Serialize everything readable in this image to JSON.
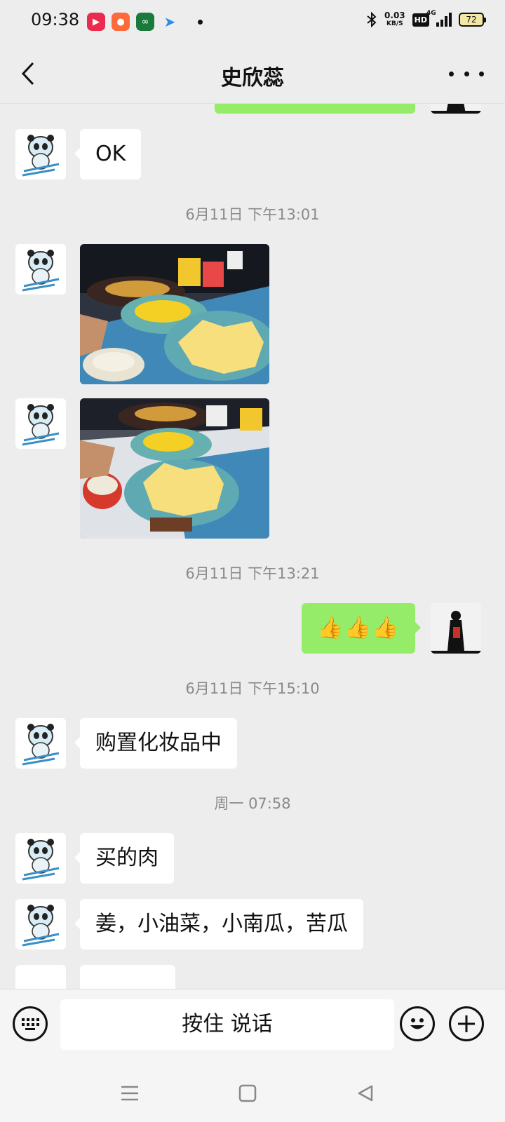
{
  "status_bar": {
    "time": "09:38",
    "net_speed_value": "0.03",
    "net_speed_unit": "KB/S",
    "hd": "HD",
    "network": "4G",
    "battery": "72"
  },
  "header": {
    "title": "史欣蕊"
  },
  "messages": {
    "m0": {
      "side": "right",
      "type": "image"
    },
    "m1": {
      "side": "left",
      "type": "text",
      "text": "OK"
    },
    "ts1": "6月11日 下午13:01",
    "m2": {
      "side": "left",
      "type": "image"
    },
    "m3": {
      "side": "left",
      "type": "image"
    },
    "ts2": "6月11日 下午13:21",
    "m4": {
      "side": "right",
      "type": "text",
      "text": "👍👍👍"
    },
    "ts3": "6月11日 下午15:10",
    "m5": {
      "side": "left",
      "type": "text",
      "text": "购置化妆品中"
    },
    "ts4": "周一 07:58",
    "m6": {
      "side": "left",
      "type": "text",
      "text": "买的肉"
    },
    "m7": {
      "side": "left",
      "type": "text",
      "text": "姜，小油菜，小南瓜，苦瓜"
    }
  },
  "input_bar": {
    "voice_label": "按住 说话"
  },
  "colors": {
    "background": "#ededed",
    "own_bubble": "#95ec69",
    "other_bubble": "#ffffff",
    "timestamp": "#8a8a8a"
  },
  "icons": {
    "back": "chevron-left-icon",
    "more": "more-icon",
    "keyboard": "keyboard-icon",
    "emoji": "emoji-icon",
    "add": "plus-icon",
    "nav_menu": "menu-icon",
    "nav_home": "home-icon",
    "nav_back": "triangle-back-icon"
  }
}
